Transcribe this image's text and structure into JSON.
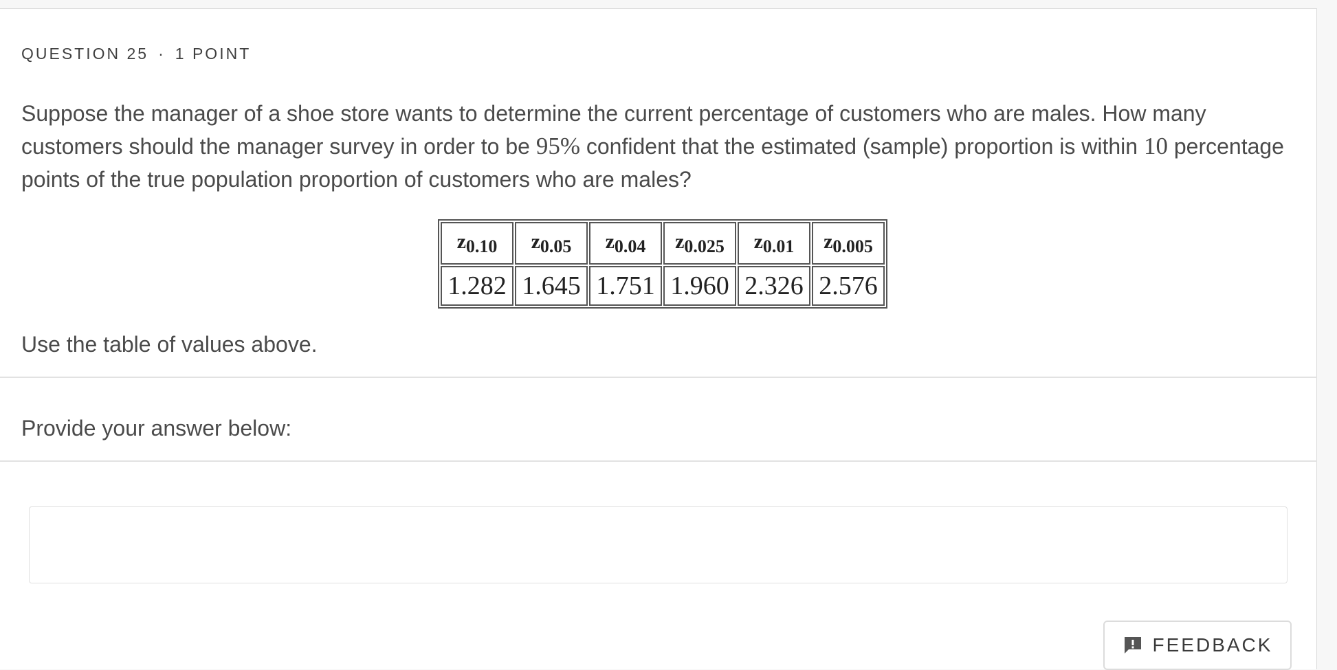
{
  "question": {
    "number_label": "QUESTION 25",
    "separator": "·",
    "points_label": "1 POINT",
    "text_part1": "Suppose the manager of a shoe store wants to determine the current percentage of customers who are males. How many customers should the manager survey in order to be ",
    "confidence": "95%",
    "text_part2": " confident that the estimated (sample) proportion is within ",
    "margin": "10",
    "text_part3": " percentage points of the true population proportion of customers who are males?",
    "note": "Use the table of values above."
  },
  "z_table": {
    "headers": [
      {
        "symbol": "z",
        "sub": "0.10"
      },
      {
        "symbol": "z",
        "sub": "0.05"
      },
      {
        "symbol": "z",
        "sub": "0.04"
      },
      {
        "symbol": "z",
        "sub": "0.025"
      },
      {
        "symbol": "z",
        "sub": "0.01"
      },
      {
        "symbol": "z",
        "sub": "0.005"
      }
    ],
    "values": [
      "1.282",
      "1.645",
      "1.751",
      "1.960",
      "2.326",
      "2.576"
    ]
  },
  "answer": {
    "prompt": "Provide your answer below:",
    "value": "",
    "placeholder": ""
  },
  "feedback": {
    "label": "FEEDBACK",
    "icon": "feedback-icon"
  }
}
